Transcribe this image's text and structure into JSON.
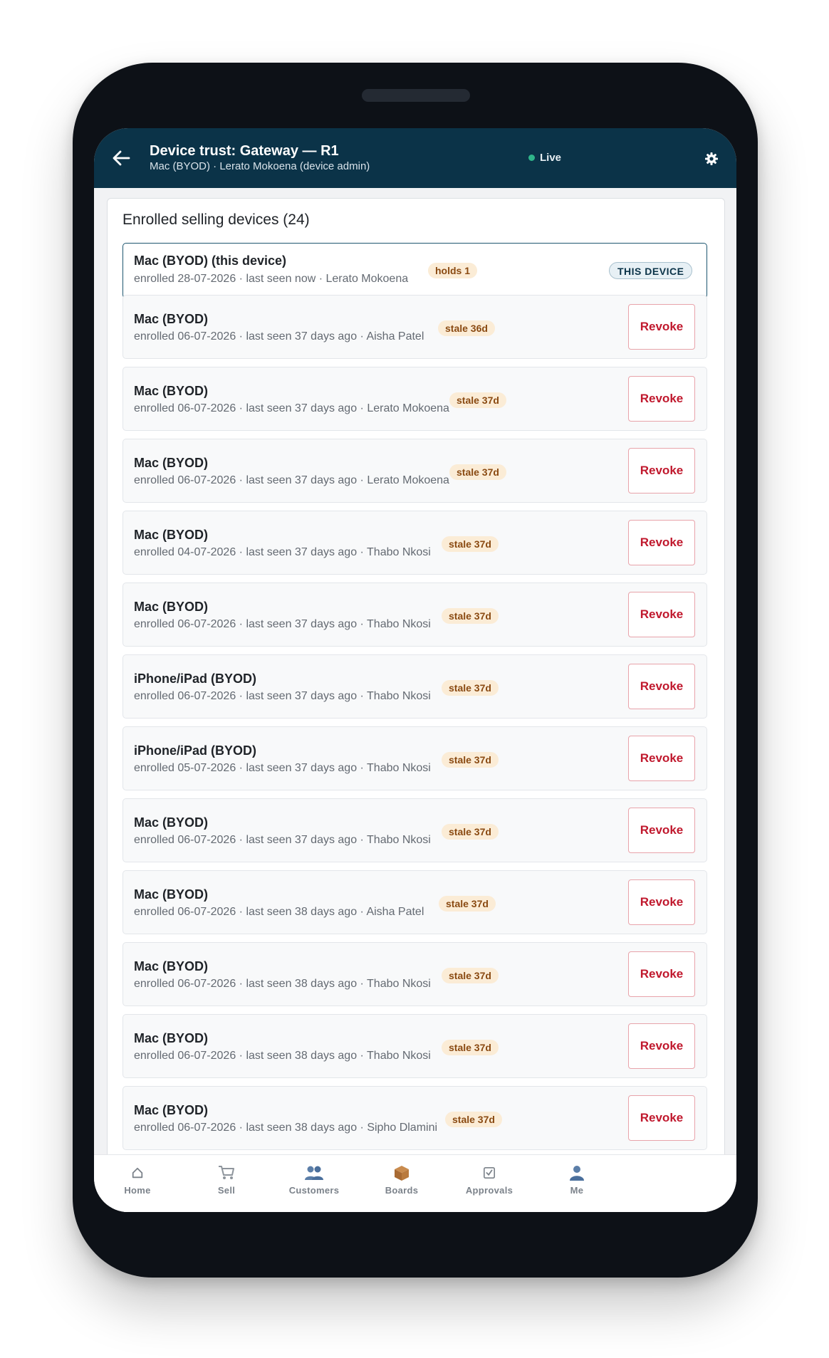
{
  "header": {
    "title": "Device trust: Gateway — R1",
    "subtitle": "Mac (BYOD) · Lerato Mokoena (device admin)",
    "status": "Live",
    "back_icon": "arrow-left-icon",
    "settings_icon": "gear-icon"
  },
  "section": {
    "title": "Enrolled selling devices (24)"
  },
  "current_device": {
    "name": "Mac (BYOD) (this device)",
    "meta": "enrolled 28-07-2026 · last seen now · Lerato Mokoena",
    "badge": "holds 1",
    "tag": "THIS DEVICE"
  },
  "devices": [
    {
      "name": "Mac (BYOD)",
      "meta": "enrolled 06-07-2026 · last seen 37 days ago · Aisha Patel",
      "badge": "stale 36d",
      "action": "Revoke"
    },
    {
      "name": "Mac (BYOD)",
      "meta": "enrolled 06-07-2026 · last seen 37 days ago · Lerato Mokoena",
      "badge": "stale 37d",
      "action": "Revoke"
    },
    {
      "name": "Mac (BYOD)",
      "meta": "enrolled 06-07-2026 · last seen 37 days ago · Lerato Mokoena",
      "badge": "stale 37d",
      "action": "Revoke"
    },
    {
      "name": "Mac (BYOD)",
      "meta": "enrolled 04-07-2026 · last seen 37 days ago · Thabo Nkosi",
      "badge": "stale 37d",
      "action": "Revoke"
    },
    {
      "name": "Mac (BYOD)",
      "meta": "enrolled 06-07-2026 · last seen 37 days ago · Thabo Nkosi",
      "badge": "stale 37d",
      "action": "Revoke"
    },
    {
      "name": "iPhone/iPad (BYOD)",
      "meta": "enrolled 06-07-2026 · last seen 37 days ago · Thabo Nkosi",
      "badge": "stale 37d",
      "action": "Revoke"
    },
    {
      "name": "iPhone/iPad (BYOD)",
      "meta": "enrolled 05-07-2026 · last seen 37 days ago · Thabo Nkosi",
      "badge": "stale 37d",
      "action": "Revoke"
    },
    {
      "name": "Mac (BYOD)",
      "meta": "enrolled 06-07-2026 · last seen 37 days ago · Thabo Nkosi",
      "badge": "stale 37d",
      "action": "Revoke"
    },
    {
      "name": "Mac (BYOD)",
      "meta": "enrolled 06-07-2026 · last seen 38 days ago · Aisha Patel",
      "badge": "stale 37d",
      "action": "Revoke"
    },
    {
      "name": "Mac (BYOD)",
      "meta": "enrolled 06-07-2026 · last seen 38 days ago · Thabo Nkosi",
      "badge": "stale 37d",
      "action": "Revoke"
    },
    {
      "name": "Mac (BYOD)",
      "meta": "enrolled 06-07-2026 · last seen 38 days ago · Thabo Nkosi",
      "badge": "stale 37d",
      "action": "Revoke"
    },
    {
      "name": "Mac (BYOD)",
      "meta": "enrolled 06-07-2026 · last seen 38 days ago · Sipho Dlamini",
      "badge": "stale 37d",
      "action": "Revoke"
    }
  ],
  "tabs": [
    {
      "label": "Home",
      "icon": "home-icon"
    },
    {
      "label": "Sell",
      "icon": "cart-icon"
    },
    {
      "label": "Customers",
      "icon": "people-icon"
    },
    {
      "label": "Boards",
      "icon": "box-icon"
    },
    {
      "label": "Approvals",
      "icon": "checkbox-icon"
    },
    {
      "label": "Me",
      "icon": "person-icon"
    }
  ],
  "colors": {
    "appbar": "#0b3348",
    "live_dot": "#2fb58a",
    "badge_bg": "#fbecd6",
    "badge_text": "#8a4a12",
    "revoke": "#c0182d"
  }
}
